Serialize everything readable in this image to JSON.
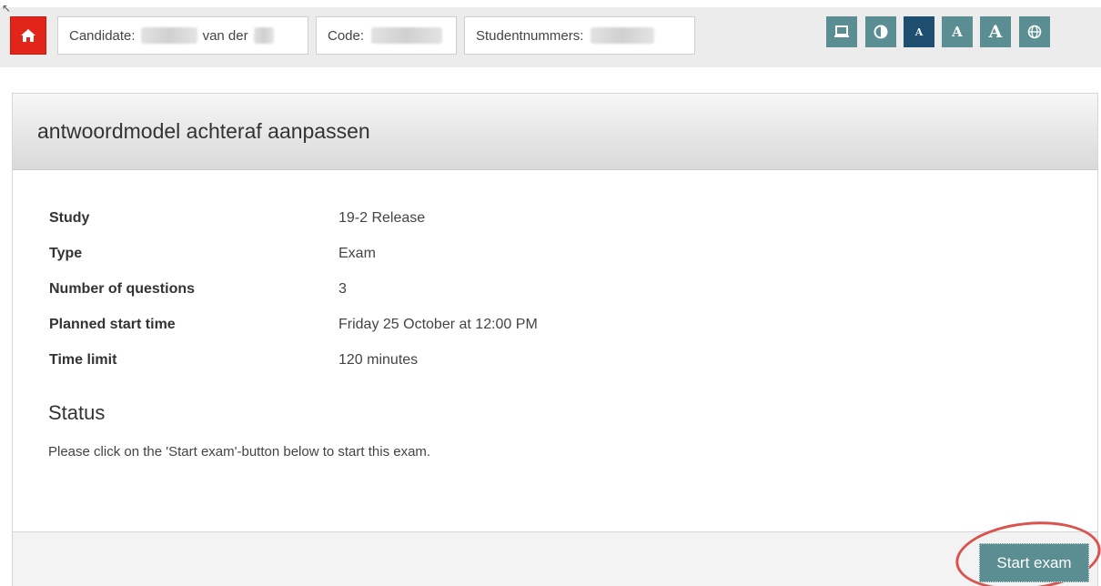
{
  "header": {
    "candidate_label": "Candidate:",
    "candidate_middle": "van der",
    "code_label": "Code:",
    "student_number_label": "Studentnummers:",
    "tools": [
      {
        "name": "screen-mode-icon",
        "glyph": "💻"
      },
      {
        "name": "contrast-icon",
        "glyph": "◑"
      },
      {
        "name": "font-size-small-icon",
        "glyph": "A"
      },
      {
        "name": "font-size-medium-icon",
        "glyph": "A"
      },
      {
        "name": "font-size-large-icon",
        "glyph": "A"
      },
      {
        "name": "globe-icon",
        "glyph": "🌐"
      }
    ]
  },
  "panel": {
    "title": "antwoordmodel achteraf aanpassen",
    "details": [
      {
        "label": "Study",
        "value": "19-2 Release"
      },
      {
        "label": "Type",
        "value": "Exam"
      },
      {
        "label": "Number of questions",
        "value": "3"
      },
      {
        "label": "Planned start time",
        "value": "Friday 25 October at 12:00 PM"
      },
      {
        "label": "Time limit",
        "value": "120 minutes"
      }
    ],
    "status_title": "Status",
    "status_text": "Please click on the 'Start exam'-button below to start this exam.",
    "start_button": "Start exam"
  },
  "colors": {
    "home": "#e1251b",
    "teal": "#5b8e93",
    "active": "#1f4f70",
    "highlight": "#d9534f"
  }
}
